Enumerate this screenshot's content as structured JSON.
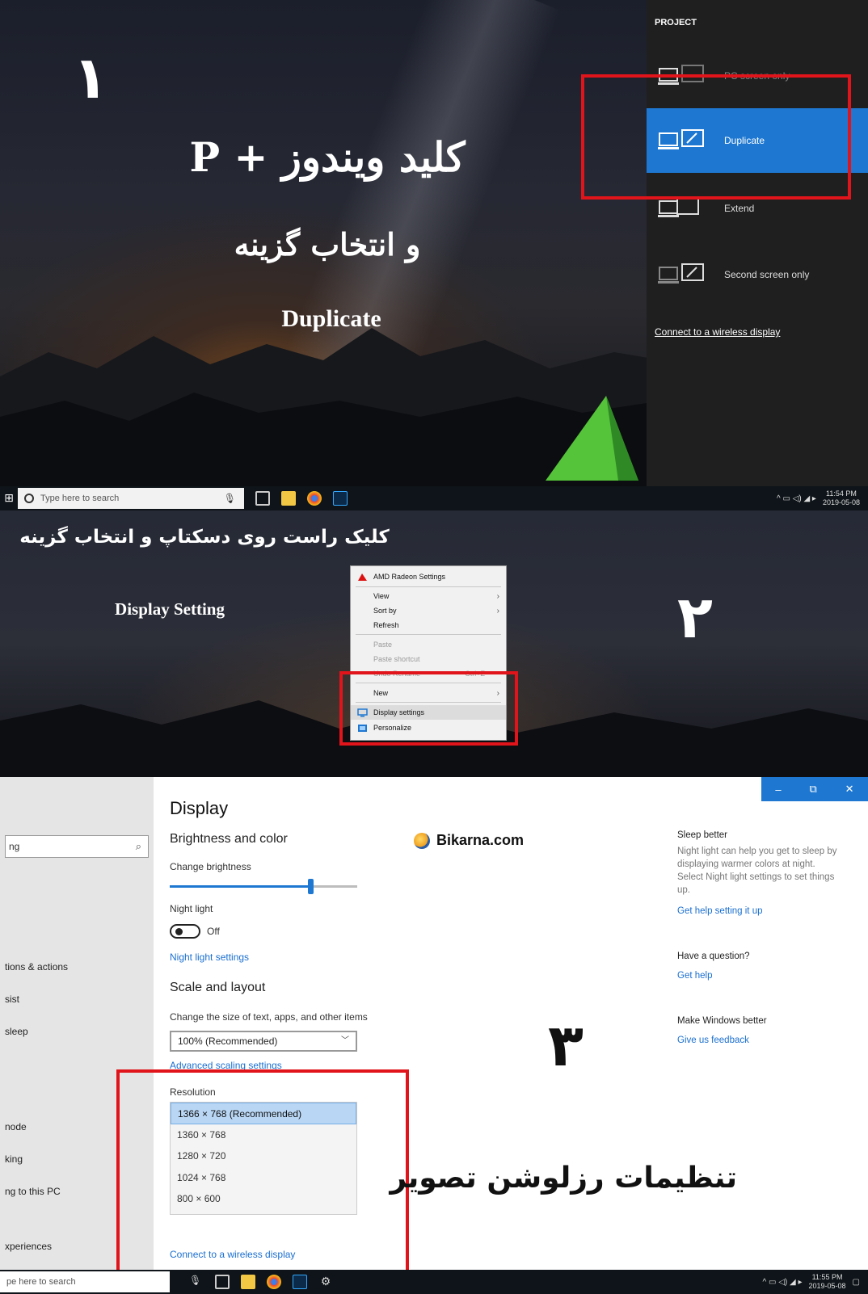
{
  "panel1": {
    "step_number": "۱",
    "line1": "کلید ویندوز + P",
    "line2": "و انتخاب گزینه",
    "line3": "Duplicate",
    "project": {
      "title": "PROJECT",
      "options": [
        {
          "label": "PC screen only",
          "selected": false
        },
        {
          "label": "Duplicate",
          "selected": true
        },
        {
          "label": "Extend",
          "selected": false
        },
        {
          "label": "Second screen only",
          "selected": false
        }
      ],
      "link": "Connect to a wireless display"
    },
    "taskbar": {
      "search_placeholder": "Type here to search",
      "time": "11:54 PM",
      "date": "2019-05-08"
    }
  },
  "panel2": {
    "line1": "کلیک راست روی دسکتاپ و انتخاب گزینه",
    "line2": "Display Setting",
    "step_number": "۲",
    "menu": {
      "amd": "AMD Radeon Settings",
      "view": "View",
      "sort_by": "Sort by",
      "refresh": "Refresh",
      "paste": "Paste",
      "paste_shortcut": "Paste shortcut",
      "undo": "Undo Rename",
      "undo_shortcut": "Ctrl+Z",
      "new": "New",
      "display_settings": "Display settings",
      "personalize": "Personalize"
    }
  },
  "panel3": {
    "sidebar": {
      "search": "ng",
      "items": [
        "tions & actions",
        "sist",
        "sleep",
        "node",
        "king",
        "ng to this PC",
        "xperiences"
      ]
    },
    "window_controls": {
      "minimize": "–",
      "restore": "⧉",
      "close": "✕"
    },
    "title": "Display",
    "brightness_heading": "Brightness and color",
    "change_brightness": "Change brightness",
    "brightness_level": 0.75,
    "night_light": "Night light",
    "night_light_state": "Off",
    "night_light_settings": "Night light settings",
    "scale_heading": "Scale and layout",
    "scale_label": "Change the size of text, apps, and other items",
    "scale_value": "100% (Recommended)",
    "advanced_scaling": "Advanced scaling settings",
    "resolution_label": "Resolution",
    "resolutions": [
      "1366 × 768 (Recommended)",
      "1360 × 768",
      "1280 × 720",
      "1024 × 768",
      "800 × 600"
    ],
    "connect_wireless": "Connect to a wireless display",
    "brand": "Bikarna.com",
    "step_number": "۳",
    "caption": "تنظیمات رزلوشن تصویر",
    "right": {
      "sleep_title": "Sleep better",
      "sleep_body": "Night light can help you get to sleep by displaying warmer colors at night. Select Night light settings to set things up.",
      "sleep_link": "Get help setting it up",
      "question_title": "Have a question?",
      "question_link": "Get help",
      "better_title": "Make Windows better",
      "better_link": "Give us feedback"
    },
    "taskbar": {
      "search_placeholder": "pe here to search",
      "time": "11:55 PM",
      "date": "2019-05-08"
    }
  }
}
